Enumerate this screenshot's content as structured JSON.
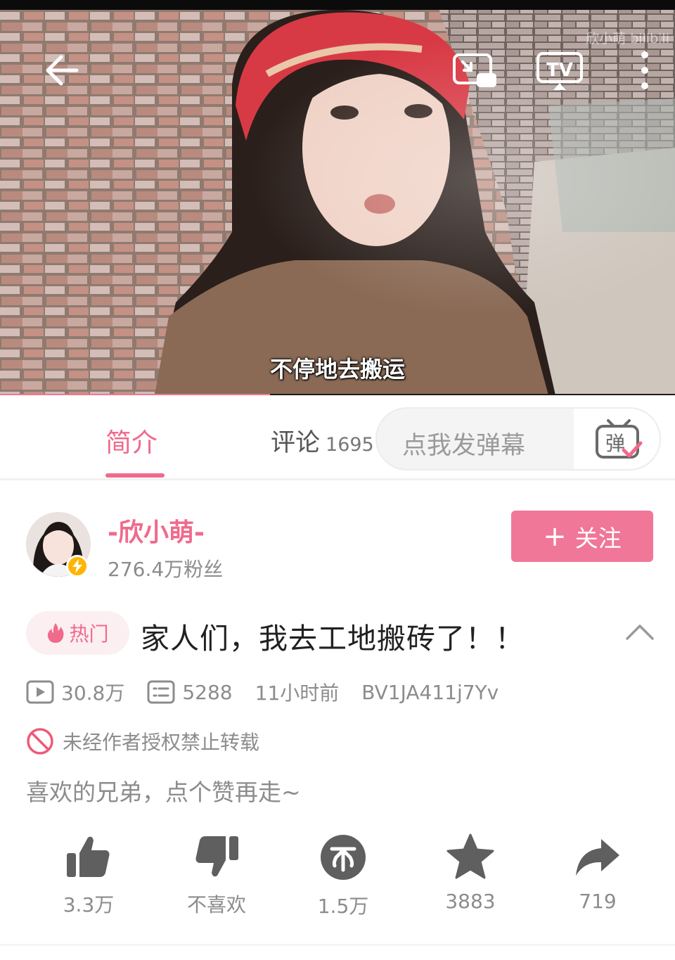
{
  "video": {
    "subtitle": "不停地去搬运",
    "watermark": "欣小萌 bilibili",
    "progress_fraction": 0.4,
    "top_icons": [
      "back-arrow-icon",
      "picture-in-picture-icon",
      "tv-cast-icon",
      "more-vertical-icon"
    ]
  },
  "tabs": {
    "intro": "简介",
    "comments": "评论",
    "comments_count": "1695"
  },
  "danmaku": {
    "placeholder": "点我发弹幕",
    "icon_char": "弹"
  },
  "uploader": {
    "name": "-欣小萌-",
    "fans": "276.4万粉丝",
    "follow_label": "关注",
    "follow_plus": "+"
  },
  "title": {
    "badge": "热门",
    "text": "家人们，我去工地搬砖了！！"
  },
  "stats": {
    "views": "30.8万",
    "danmaku_count": "5288",
    "published": "11小时前",
    "bvid": "BV1JA411j7Yv"
  },
  "copyright": "未经作者授权禁止转载",
  "description": "喜欢的兄弟，点个赞再走~",
  "actions": {
    "like": "3.3万",
    "dislike": "不喜欢",
    "coin": "1.5万",
    "favorite": "3883",
    "share": "719"
  },
  "colors": {
    "accent_pink": "#f06a8c",
    "follow_bg": "#f07797",
    "icon_gray": "#5f5f5f",
    "meta_gray": "#8c8c8c"
  }
}
